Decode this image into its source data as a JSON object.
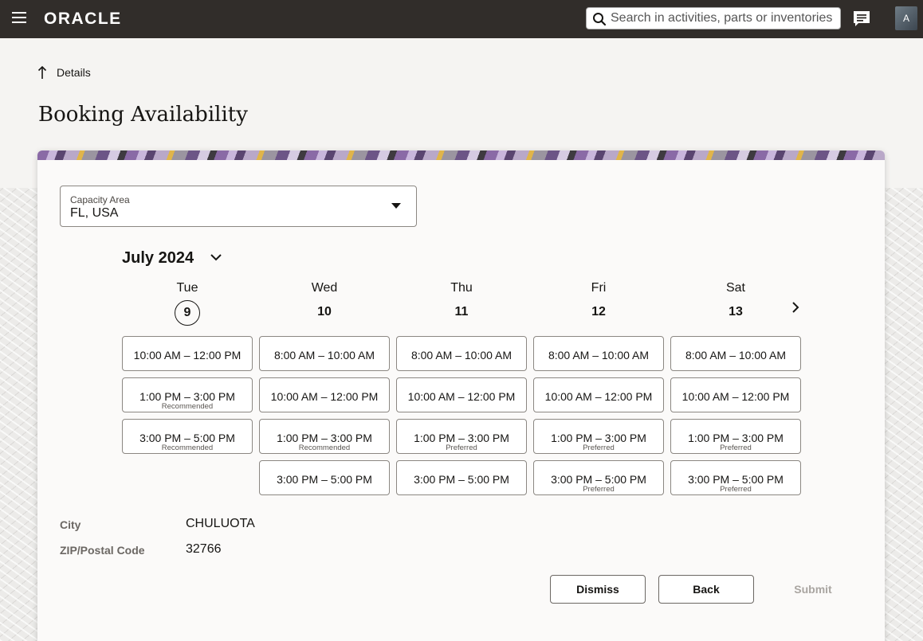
{
  "header": {
    "logo": "ORACLE",
    "search_placeholder": "Search in activities, parts or inventories",
    "avatar_initial": "A"
  },
  "page": {
    "back_label": "Details",
    "title": "Booking Availability"
  },
  "capacity_area": {
    "label": "Capacity Area",
    "value": "FL, USA"
  },
  "calendar": {
    "month": "July 2024",
    "days": [
      {
        "name": "Tue",
        "num": "9",
        "today": true,
        "slots": [
          {
            "time": "10:00 AM – 12:00 PM",
            "note": ""
          },
          {
            "time": "1:00 PM – 3:00 PM",
            "note": "Recommended"
          },
          {
            "time": "3:00 PM – 5:00 PM",
            "note": "Recommended"
          }
        ]
      },
      {
        "name": "Wed",
        "num": "10",
        "today": false,
        "slots": [
          {
            "time": "8:00 AM – 10:00 AM",
            "note": ""
          },
          {
            "time": "10:00 AM – 12:00 PM",
            "note": ""
          },
          {
            "time": "1:00 PM – 3:00 PM",
            "note": "Recommended"
          },
          {
            "time": "3:00 PM – 5:00 PM",
            "note": ""
          }
        ]
      },
      {
        "name": "Thu",
        "num": "11",
        "today": false,
        "slots": [
          {
            "time": "8:00 AM – 10:00 AM",
            "note": ""
          },
          {
            "time": "10:00 AM – 12:00 PM",
            "note": ""
          },
          {
            "time": "1:00 PM – 3:00 PM",
            "note": "Preferred"
          },
          {
            "time": "3:00 PM – 5:00 PM",
            "note": ""
          }
        ]
      },
      {
        "name": "Fri",
        "num": "12",
        "today": false,
        "slots": [
          {
            "time": "8:00 AM – 10:00 AM",
            "note": ""
          },
          {
            "time": "10:00 AM – 12:00 PM",
            "note": ""
          },
          {
            "time": "1:00 PM – 3:00 PM",
            "note": "Preferred"
          },
          {
            "time": "3:00 PM – 5:00 PM",
            "note": "Preferred"
          }
        ]
      },
      {
        "name": "Sat",
        "num": "13",
        "today": false,
        "slots": [
          {
            "time": "8:00 AM – 10:00 AM",
            "note": ""
          },
          {
            "time": "10:00 AM – 12:00 PM",
            "note": ""
          },
          {
            "time": "1:00 PM – 3:00 PM",
            "note": "Preferred"
          },
          {
            "time": "3:00 PM – 5:00 PM",
            "note": "Preferred"
          }
        ]
      }
    ]
  },
  "info": {
    "city_label": "City",
    "city_value": "CHULUOTA",
    "zip_label": "ZIP/Postal Code",
    "zip_value": "32766"
  },
  "actions": {
    "dismiss": "Dismiss",
    "back": "Back",
    "submit": "Submit"
  }
}
